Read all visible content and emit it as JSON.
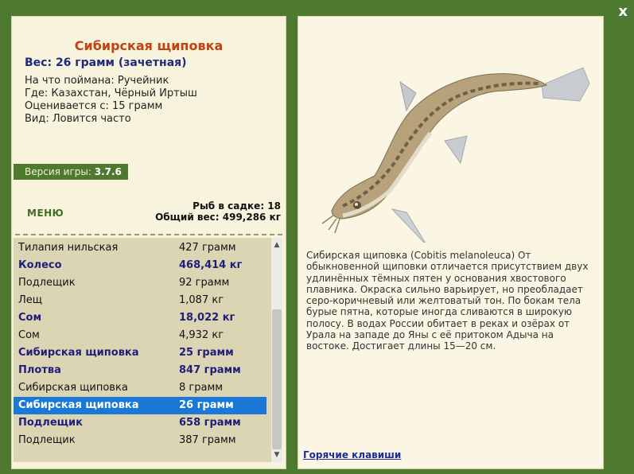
{
  "close_label": "x",
  "fish": {
    "title": "Сибирская щиповка",
    "weight": "Вес: 26 грамм (зачетная)",
    "caught_on": "На что поймана: Ручейник",
    "location": "Где: Казахстан, Чёрный Иртыш",
    "value": "Оценивается с: 15 грамм",
    "kind": "Вид: Ловится часто"
  },
  "version": {
    "label": "Версия игры:",
    "number": "3.7.6"
  },
  "menu_label": "МЕНЮ",
  "cage": {
    "count": "Рыб в садке: 18",
    "total": "Общий вес: 499,286 кг"
  },
  "catch_list": [
    {
      "name": "Тилапия нильская",
      "weight": "427 грамм",
      "style": "normal"
    },
    {
      "name": "Колесо",
      "weight": "468,414 кг",
      "style": "bold"
    },
    {
      "name": "Подлещик",
      "weight": "92 грамм",
      "style": "normal"
    },
    {
      "name": "Лещ",
      "weight": "1,087 кг",
      "style": "normal"
    },
    {
      "name": "Сом",
      "weight": "18,022 кг",
      "style": "bold"
    },
    {
      "name": "Сом",
      "weight": "4,932 кг",
      "style": "normal"
    },
    {
      "name": "Сибирская щиповка",
      "weight": "25 грамм",
      "style": "bold"
    },
    {
      "name": "Плотва",
      "weight": "847 грамм",
      "style": "bold"
    },
    {
      "name": "Сибирская щиповка",
      "weight": "8 грамм",
      "style": "normal"
    },
    {
      "name": "Сибирская щиповка",
      "weight": "26 грамм",
      "style": "selected"
    },
    {
      "name": "Подлещик",
      "weight": "658 грамм",
      "style": "bold"
    },
    {
      "name": "Подлещик",
      "weight": "387 грамм",
      "style": "normal"
    }
  ],
  "description": "Сибирская щиповка (Cobitis melanoleuca) От обыкновенной щиповки отличается присутствием двух удлинённых тёмных пятен у основания хвостового плавника. Окраска сильно варьирует, но преобладает серо-коричневый или желтоватый тон. По бокам тела бурые пятна, которые иногда сливаются в широкую полосу. В водах России обитает в реках и озёрах от Урала на западе до Яны с её притоком Адыча на востоке. Достигает длины 15—20 см.",
  "hotkeys_label": "Горячие клавиши",
  "colors": {
    "background": "#4d7a2e",
    "selected": "#1a79d6",
    "title": "#c0440f",
    "highlight_text": "#1f1f7a"
  }
}
